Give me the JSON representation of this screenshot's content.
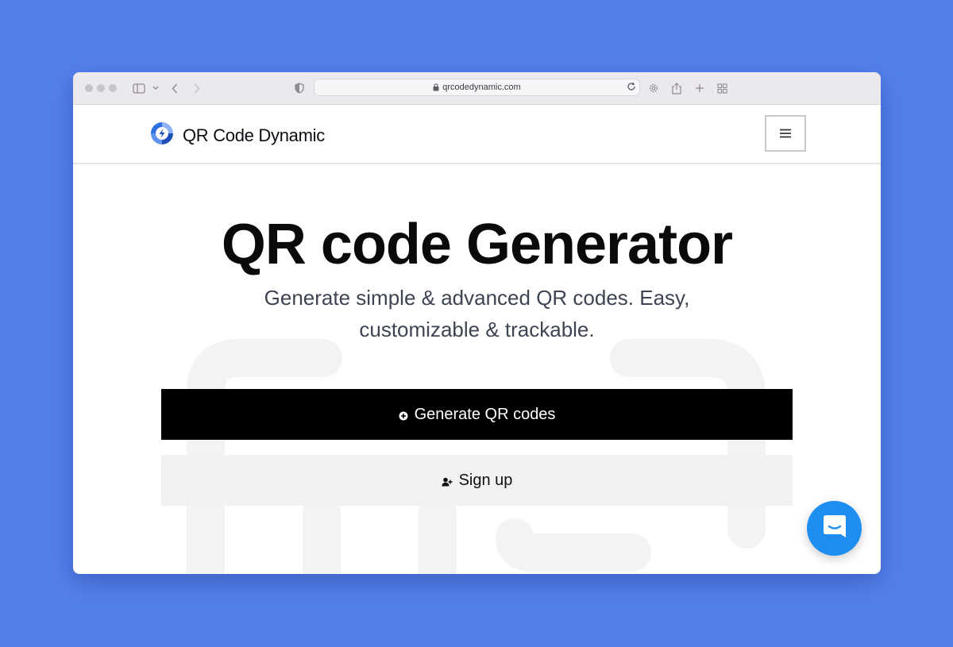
{
  "browser": {
    "url": "qrcodedynamic.com"
  },
  "header": {
    "brand": "QR Code Dynamic",
    "menu_icon": "menu-icon"
  },
  "hero": {
    "title": "QR code Generator",
    "subtitle": "Generate simple & advanced QR codes. Easy, customizable & trackable.",
    "primary_button": "Generate QR codes",
    "secondary_button": "Sign up"
  },
  "colors": {
    "page_background": "#5480ea",
    "primary_button": "#000000",
    "secondary_button": "#f1f2f4",
    "chat_button": "#1f8ef1"
  }
}
